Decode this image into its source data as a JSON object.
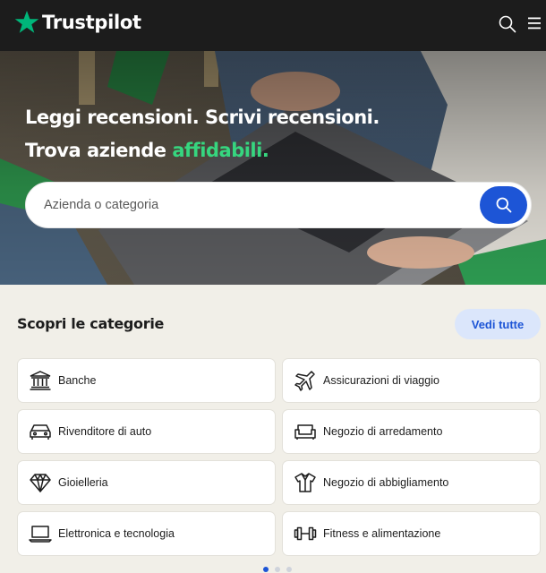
{
  "header": {
    "brand": "Trustpilot",
    "brand_color": "#00b67a",
    "icons": [
      "star-logo-icon",
      "search-icon",
      "menu-icon"
    ]
  },
  "hero": {
    "headline_line1": "Leggi recensioni. Scrivi recensioni.",
    "headline_line2_prefix": "Trova aziende ",
    "headline_line2_accent": "affidabili.",
    "accent_color": "#36d67f",
    "search": {
      "value": "",
      "placeholder": "Azienda o categoria",
      "button_icon": "search-icon",
      "button_color": "#1d55d6"
    }
  },
  "categories": {
    "title": "Scopri le categorie",
    "see_all_label": "Vedi tutte",
    "items": [
      {
        "label": "Banche",
        "icon": "bank-icon"
      },
      {
        "label": "Assicurazioni di viaggio",
        "icon": "airplane-icon"
      },
      {
        "label": "Rivenditore di auto",
        "icon": "car-icon"
      },
      {
        "label": "Negozio di arredamento",
        "icon": "sofa-icon"
      },
      {
        "label": "Gioielleria",
        "icon": "diamond-icon"
      },
      {
        "label": "Negozio di abbigliamento",
        "icon": "shirt-icon"
      },
      {
        "label": "Elettronica e tecnologia",
        "icon": "laptop-icon"
      },
      {
        "label": "Fitness e alimentazione",
        "icon": "dumbbell-icon"
      }
    ],
    "pagination": {
      "pages": 3,
      "current": 1
    }
  }
}
